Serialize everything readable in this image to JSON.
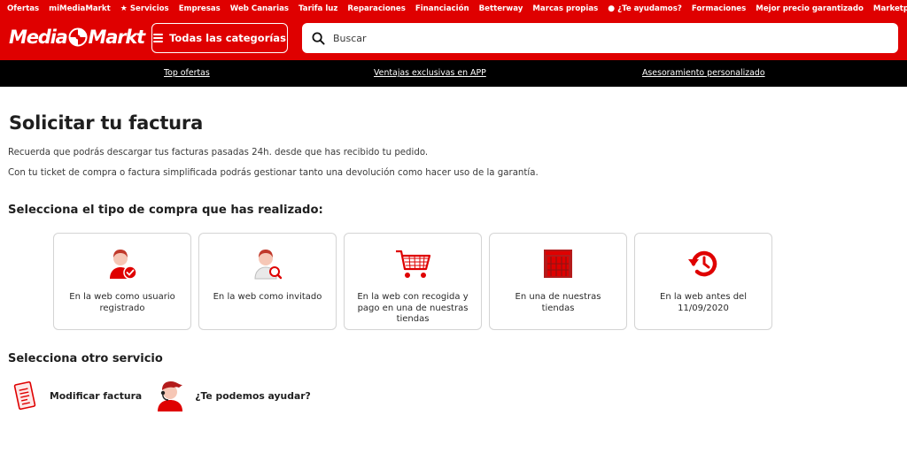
{
  "topnav": {
    "items": [
      {
        "label": "Ofertas"
      },
      {
        "label": "miMediaMarkt"
      },
      {
        "label": "Servicios",
        "icon": "star-icon"
      },
      {
        "label": "Empresas"
      },
      {
        "label": "Web Canarias"
      },
      {
        "label": "Tarifa luz"
      },
      {
        "label": "Reparaciones"
      },
      {
        "label": "Financiación"
      },
      {
        "label": "Betterway"
      },
      {
        "label": "Marcas propias"
      },
      {
        "label": "¿Te ayudamos?",
        "icon": "info-icon"
      },
      {
        "label": "Formaciones"
      },
      {
        "label": "Mejor precio garantizado"
      },
      {
        "label": "Marketplace"
      }
    ]
  },
  "brand": {
    "name_left": "Media",
    "name_right": "Markt",
    "color": "#df0000"
  },
  "categories_button": {
    "label": "Todas las categorías"
  },
  "search": {
    "placeholder": "Buscar"
  },
  "promo": {
    "links": [
      {
        "label": "Top ofertas"
      },
      {
        "label": "Ventajas exclusivas en APP"
      },
      {
        "label": "Asesoramiento personalizado"
      }
    ]
  },
  "page": {
    "title": "Solicitar tu factura",
    "paragraph_1": "Recuerda que podrás descargar tus facturas pasadas 24h. desde que has recibido tu pedido.",
    "paragraph_2": "Con tu ticket de compra o factura simplificada podrás gestionar tanto una devolución como hacer uso de la garantía.",
    "purchase_type_heading": "Selecciona el tipo de compra que has realizado:",
    "purchase_types": [
      {
        "label": "En la web como usuario registrado",
        "icon": "registered-user-icon"
      },
      {
        "label": "En la web como invitado",
        "icon": "guest-user-icon"
      },
      {
        "label": "En la web con recogida y pago en una de nuestras tiendas",
        "icon": "shopping-cart-icon"
      },
      {
        "label": "En una de nuestras tiendas",
        "icon": "store-icon"
      },
      {
        "label": "En la web antes del 11/09/2020",
        "icon": "history-icon"
      }
    ],
    "other_service_heading": "Selecciona otro servicio",
    "services": [
      {
        "label": "Modificar factura",
        "icon": "invoice-icon"
      },
      {
        "label": "¿Te podemos ayudar?",
        "icon": "support-agent-icon"
      }
    ]
  }
}
